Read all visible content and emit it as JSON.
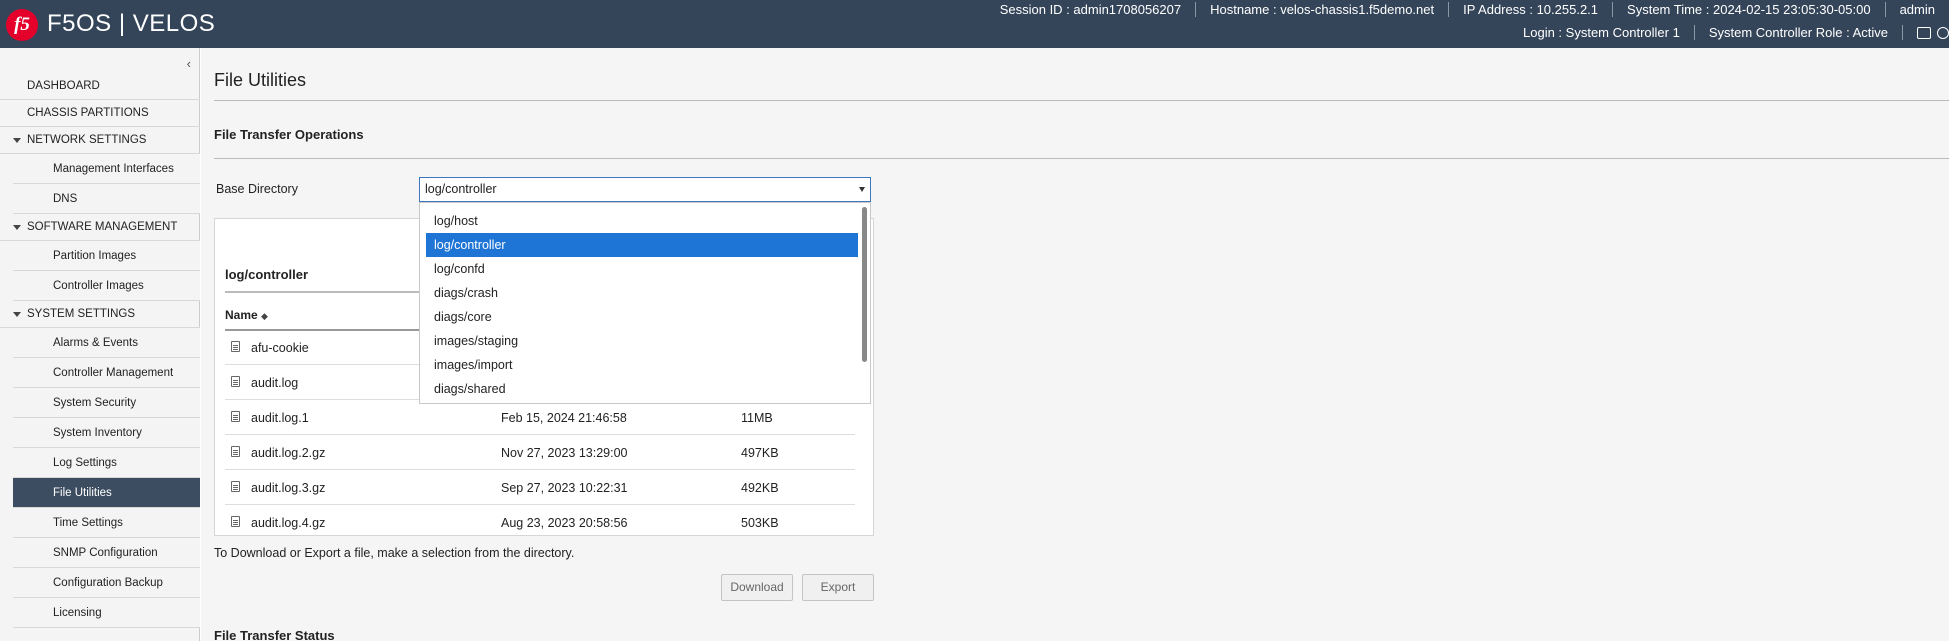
{
  "header": {
    "logo_text": "f5",
    "brand": "F5OS | VELOS",
    "session": "Session ID : admin1708056207",
    "hostname": "Hostname : velos-chassis1.f5demo.net",
    "ip": "IP Address : 10.255.2.1",
    "time": "System Time : 2024-02-15 23:05:30-05:00",
    "user": "admin",
    "login": "Login : System Controller 1",
    "role": "System Controller Role : Active",
    "icons": [
      "book-icon",
      "help-icon"
    ]
  },
  "sidebar": {
    "collapse_glyph": "‹",
    "items": [
      {
        "type": "top",
        "label": "DASHBOARD"
      },
      {
        "type": "top",
        "label": "CHASSIS PARTITIONS"
      },
      {
        "type": "section",
        "label": "NETWORK SETTINGS"
      },
      {
        "type": "sub",
        "label": "Management Interfaces"
      },
      {
        "type": "sub",
        "label": "DNS"
      },
      {
        "type": "section",
        "label": "SOFTWARE MANAGEMENT"
      },
      {
        "type": "sub",
        "label": "Partition Images"
      },
      {
        "type": "sub",
        "label": "Controller Images"
      },
      {
        "type": "section",
        "label": "SYSTEM SETTINGS"
      },
      {
        "type": "sub",
        "label": "Alarms & Events"
      },
      {
        "type": "sub",
        "label": "Controller Management"
      },
      {
        "type": "sub",
        "label": "System Security"
      },
      {
        "type": "sub",
        "label": "System Inventory"
      },
      {
        "type": "sub",
        "label": "Log Settings"
      },
      {
        "type": "sub",
        "label": "File Utilities",
        "active": true
      },
      {
        "type": "sub",
        "label": "Time Settings"
      },
      {
        "type": "sub",
        "label": "SNMP Configuration"
      },
      {
        "type": "sub",
        "label": "Configuration Backup"
      },
      {
        "type": "sub",
        "label": "Licensing"
      }
    ]
  },
  "main": {
    "title": "File Utilities",
    "transfer_section": "File Transfer Operations",
    "base_dir_label": "Base Directory",
    "base_dir_value": "log/controller",
    "dropdown_options": [
      "log/host",
      "log/controller",
      "log/confd",
      "diags/crash",
      "diags/core",
      "images/staging",
      "images/import",
      "diags/shared"
    ],
    "dropdown_selected_index": 1,
    "panel_title": "log/controller",
    "col_name": "Name",
    "sort_glyph": "◆",
    "files": [
      {
        "name": "afu-cookie",
        "date": "",
        "size": ""
      },
      {
        "name": "audit.log",
        "date": "",
        "size": ""
      },
      {
        "name": "audit.log.1",
        "date": "Feb 15, 2024 21:46:58",
        "size": "11MB"
      },
      {
        "name": "audit.log.2.gz",
        "date": "Nov 27, 2023 13:29:00",
        "size": "497KB"
      },
      {
        "name": "audit.log.3.gz",
        "date": "Sep 27, 2023 10:22:31",
        "size": "492KB"
      },
      {
        "name": "audit.log.4.gz",
        "date": "Aug 23, 2023 20:58:56",
        "size": "503KB"
      }
    ],
    "hint": "To Download or Export a file, make a selection from the directory.",
    "download_label": "Download",
    "export_label": "Export",
    "status_section": "File Transfer Status"
  },
  "colors": {
    "topbar": "#34455a",
    "logo": "#e4002b",
    "active_nav": "#3d4d61",
    "selected_option": "#1f75d6"
  }
}
